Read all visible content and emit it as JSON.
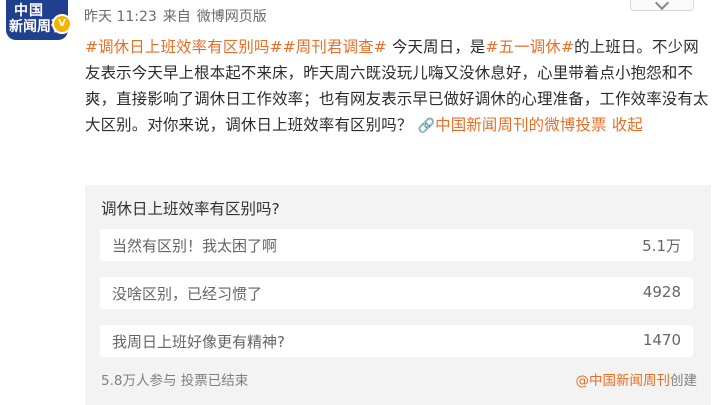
{
  "account": {
    "avatar_line1": "中国",
    "avatar_line2": "新闻周刊",
    "verified_icon": "verified-badge-icon"
  },
  "meta": {
    "time": "昨天 11:23",
    "from": "来自",
    "source": "微博网页版"
  },
  "post": {
    "tag1": "#调休日上班效率有区别吗#",
    "tag2": "#周刊君调查#",
    "text1": " 今天周日，是",
    "tag3": "#五一调休#",
    "text2": "的上班日。不少网友表示今天早上根本起不来床，昨天周六既没玩儿嗨又没休息好，心里带着点小抱怨和不爽，直接影响了调休日工作效率；也有网友表示早已做好调休的心理准备，工作效率没有太大区别。对你来说，调休日上班效率有区别吗？",
    "link_icon": "link-icon",
    "link_text": "中国新闻周刊的微博投票",
    "collapse": "收起"
  },
  "poll": {
    "title": "调休日上班效率有区别吗?",
    "options": [
      {
        "label": "当然有区别！我太困了啊",
        "count": "5.1万"
      },
      {
        "label": "没啥区别，已经习惯了",
        "count": "4928"
      },
      {
        "label": "我周日上班好像更有精神?",
        "count": "1470"
      }
    ],
    "footer": "5.8万人参与 投票已结束",
    "credit_source": "@中国新闻周刊",
    "credit_suffix": "创建"
  },
  "colors": {
    "accent": "#e86e25",
    "avatar_bg": "#1f3f8f",
    "poll_bg": "#f3f3f3"
  }
}
